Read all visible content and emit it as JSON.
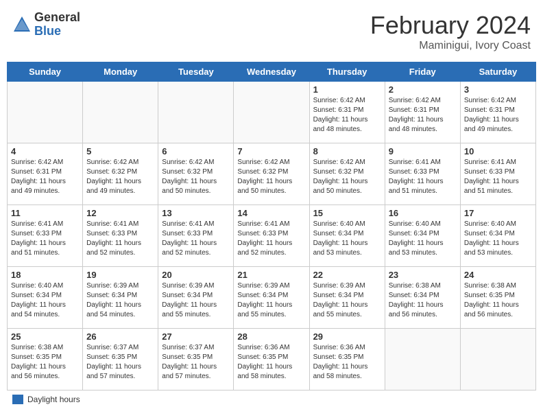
{
  "header": {
    "logo_general": "General",
    "logo_blue": "Blue",
    "title": "February 2024",
    "subtitle": "Maminigui, Ivory Coast"
  },
  "days_of_week": [
    "Sunday",
    "Monday",
    "Tuesday",
    "Wednesday",
    "Thursday",
    "Friday",
    "Saturday"
  ],
  "weeks": [
    [
      {
        "day": "",
        "info": ""
      },
      {
        "day": "",
        "info": ""
      },
      {
        "day": "",
        "info": ""
      },
      {
        "day": "",
        "info": ""
      },
      {
        "day": "1",
        "info": "Sunrise: 6:42 AM\nSunset: 6:31 PM\nDaylight: 11 hours and 48 minutes."
      },
      {
        "day": "2",
        "info": "Sunrise: 6:42 AM\nSunset: 6:31 PM\nDaylight: 11 hours and 48 minutes."
      },
      {
        "day": "3",
        "info": "Sunrise: 6:42 AM\nSunset: 6:31 PM\nDaylight: 11 hours and 49 minutes."
      }
    ],
    [
      {
        "day": "4",
        "info": "Sunrise: 6:42 AM\nSunset: 6:31 PM\nDaylight: 11 hours and 49 minutes."
      },
      {
        "day": "5",
        "info": "Sunrise: 6:42 AM\nSunset: 6:32 PM\nDaylight: 11 hours and 49 minutes."
      },
      {
        "day": "6",
        "info": "Sunrise: 6:42 AM\nSunset: 6:32 PM\nDaylight: 11 hours and 50 minutes."
      },
      {
        "day": "7",
        "info": "Sunrise: 6:42 AM\nSunset: 6:32 PM\nDaylight: 11 hours and 50 minutes."
      },
      {
        "day": "8",
        "info": "Sunrise: 6:42 AM\nSunset: 6:32 PM\nDaylight: 11 hours and 50 minutes."
      },
      {
        "day": "9",
        "info": "Sunrise: 6:41 AM\nSunset: 6:33 PM\nDaylight: 11 hours and 51 minutes."
      },
      {
        "day": "10",
        "info": "Sunrise: 6:41 AM\nSunset: 6:33 PM\nDaylight: 11 hours and 51 minutes."
      }
    ],
    [
      {
        "day": "11",
        "info": "Sunrise: 6:41 AM\nSunset: 6:33 PM\nDaylight: 11 hours and 51 minutes."
      },
      {
        "day": "12",
        "info": "Sunrise: 6:41 AM\nSunset: 6:33 PM\nDaylight: 11 hours and 52 minutes."
      },
      {
        "day": "13",
        "info": "Sunrise: 6:41 AM\nSunset: 6:33 PM\nDaylight: 11 hours and 52 minutes."
      },
      {
        "day": "14",
        "info": "Sunrise: 6:41 AM\nSunset: 6:33 PM\nDaylight: 11 hours and 52 minutes."
      },
      {
        "day": "15",
        "info": "Sunrise: 6:40 AM\nSunset: 6:34 PM\nDaylight: 11 hours and 53 minutes."
      },
      {
        "day": "16",
        "info": "Sunrise: 6:40 AM\nSunset: 6:34 PM\nDaylight: 11 hours and 53 minutes."
      },
      {
        "day": "17",
        "info": "Sunrise: 6:40 AM\nSunset: 6:34 PM\nDaylight: 11 hours and 53 minutes."
      }
    ],
    [
      {
        "day": "18",
        "info": "Sunrise: 6:40 AM\nSunset: 6:34 PM\nDaylight: 11 hours and 54 minutes."
      },
      {
        "day": "19",
        "info": "Sunrise: 6:39 AM\nSunset: 6:34 PM\nDaylight: 11 hours and 54 minutes."
      },
      {
        "day": "20",
        "info": "Sunrise: 6:39 AM\nSunset: 6:34 PM\nDaylight: 11 hours and 55 minutes."
      },
      {
        "day": "21",
        "info": "Sunrise: 6:39 AM\nSunset: 6:34 PM\nDaylight: 11 hours and 55 minutes."
      },
      {
        "day": "22",
        "info": "Sunrise: 6:39 AM\nSunset: 6:34 PM\nDaylight: 11 hours and 55 minutes."
      },
      {
        "day": "23",
        "info": "Sunrise: 6:38 AM\nSunset: 6:34 PM\nDaylight: 11 hours and 56 minutes."
      },
      {
        "day": "24",
        "info": "Sunrise: 6:38 AM\nSunset: 6:35 PM\nDaylight: 11 hours and 56 minutes."
      }
    ],
    [
      {
        "day": "25",
        "info": "Sunrise: 6:38 AM\nSunset: 6:35 PM\nDaylight: 11 hours and 56 minutes."
      },
      {
        "day": "26",
        "info": "Sunrise: 6:37 AM\nSunset: 6:35 PM\nDaylight: 11 hours and 57 minutes."
      },
      {
        "day": "27",
        "info": "Sunrise: 6:37 AM\nSunset: 6:35 PM\nDaylight: 11 hours and 57 minutes."
      },
      {
        "day": "28",
        "info": "Sunrise: 6:36 AM\nSunset: 6:35 PM\nDaylight: 11 hours and 58 minutes."
      },
      {
        "day": "29",
        "info": "Sunrise: 6:36 AM\nSunset: 6:35 PM\nDaylight: 11 hours and 58 minutes."
      },
      {
        "day": "",
        "info": ""
      },
      {
        "day": "",
        "info": ""
      }
    ]
  ],
  "legend": {
    "box_label": "daylight-indicator",
    "text": "Daylight hours"
  }
}
